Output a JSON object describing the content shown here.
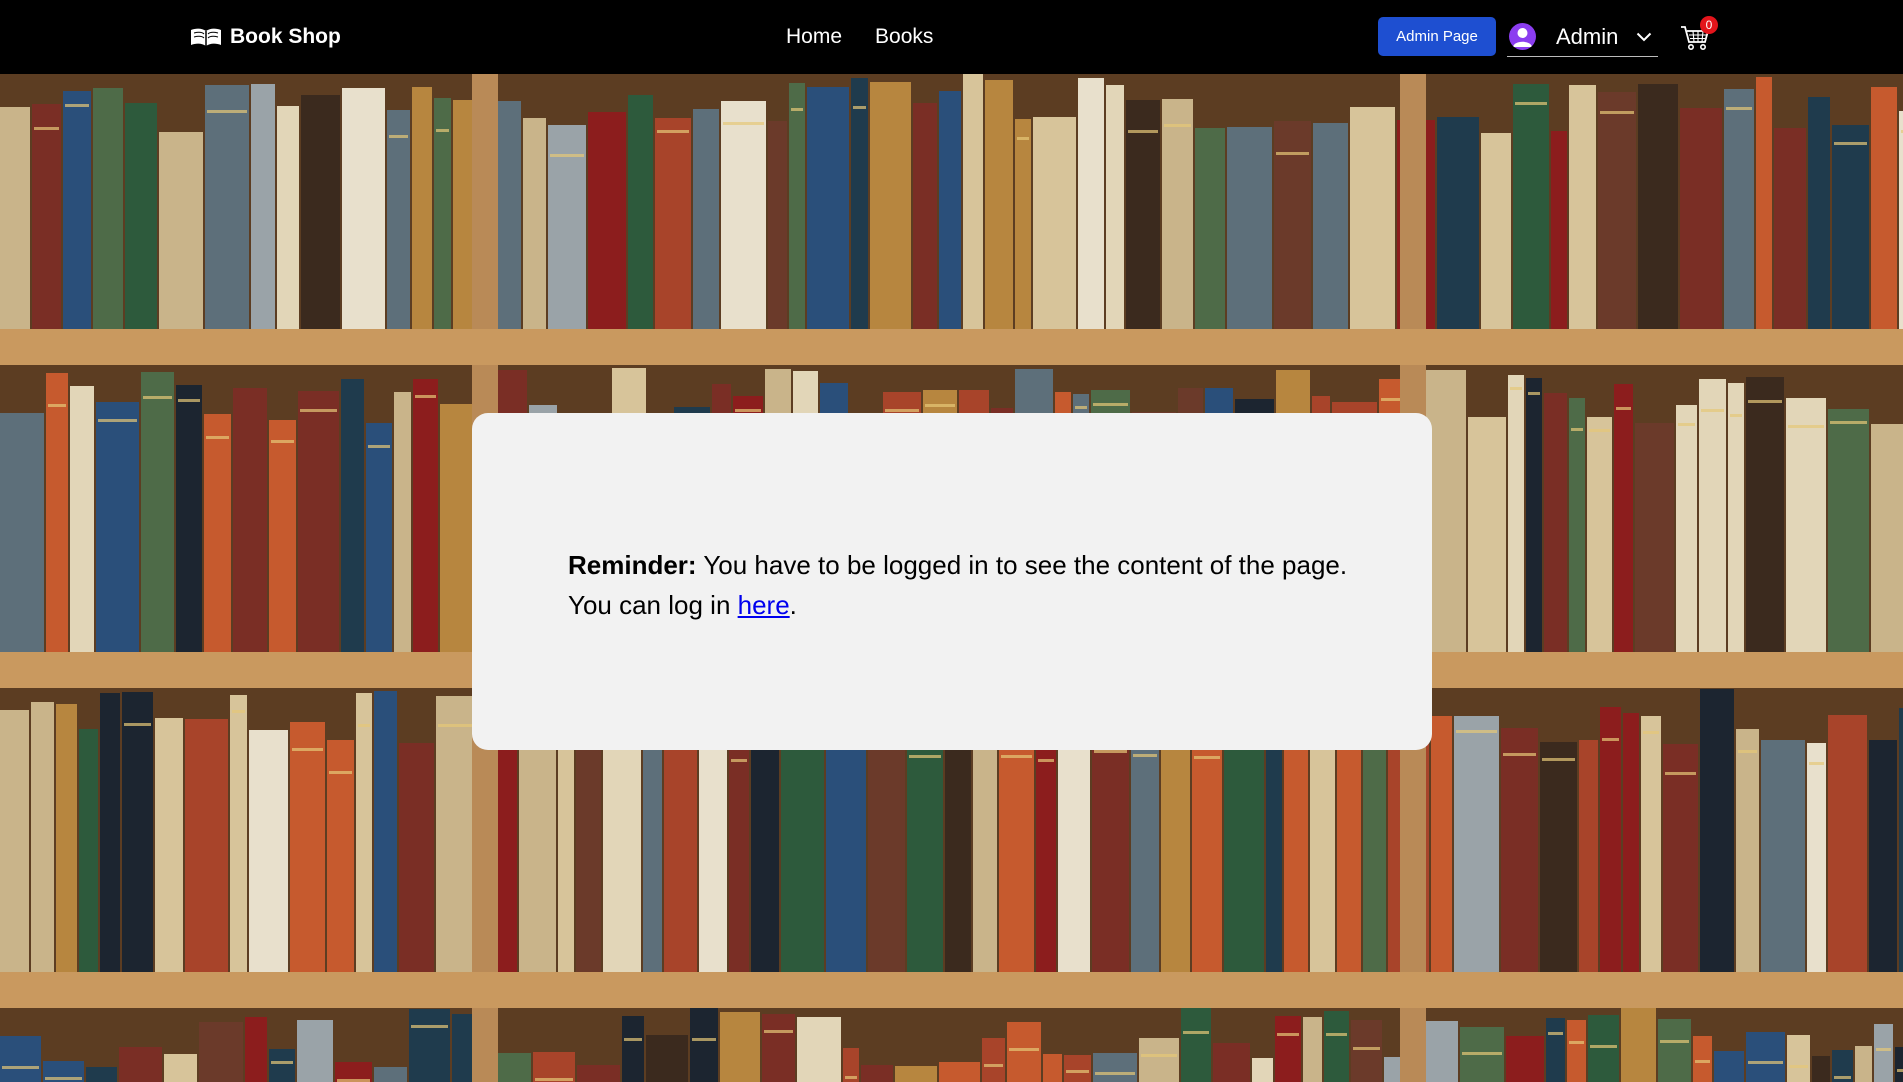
{
  "navbar": {
    "brand": {
      "icon": "open-book-icon",
      "title": "Book Shop"
    },
    "links": [
      {
        "label": "Home"
      },
      {
        "label": "Books"
      }
    ],
    "admin_page_button": "Admin Page",
    "user": {
      "icon": "user-avatar-icon",
      "name": "Admin",
      "dropdown_icon": "chevron-down-icon"
    },
    "cart": {
      "icon": "shopping-cart-icon",
      "count": "0"
    }
  },
  "reminder": {
    "bold_label": "Reminder:",
    "message": " You have to be logged in to see the content of the page. You can log in ",
    "link_text": "here",
    "trailing": "."
  },
  "colors": {
    "navbar_bg": "#000000",
    "admin_button": "#1e4fd1",
    "avatar": "#8b3df0",
    "cart_badge": "#e3141b",
    "card_bg": "#f2f2f2",
    "link": "#0000ee"
  }
}
